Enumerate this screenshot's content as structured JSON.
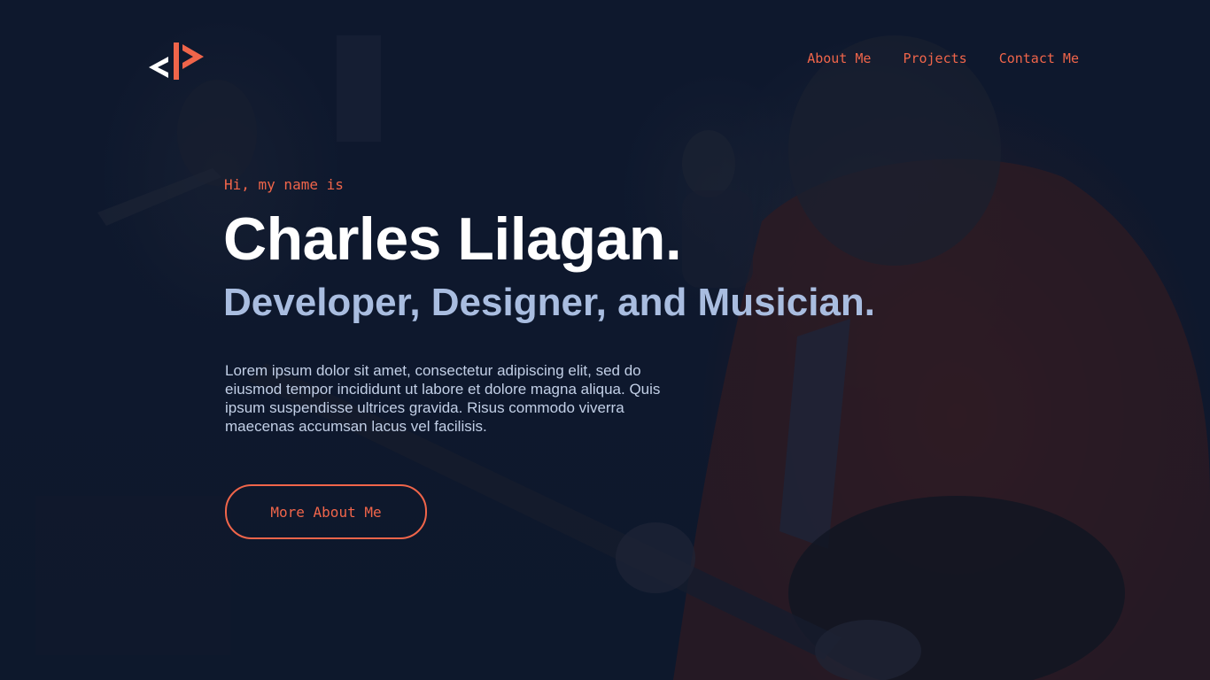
{
  "brand": {
    "logo_icon": "code-brackets-logo-icon",
    "accent_color": "#f0654a",
    "white_color": "#ffffff"
  },
  "nav": {
    "items": [
      {
        "label": "About Me"
      },
      {
        "label": "Projects"
      },
      {
        "label": "Contact Me"
      }
    ]
  },
  "hero": {
    "greeting": "Hi, my name is",
    "name": "Charles Lilagan.",
    "tagline": "Developer, Designer, and Musician.",
    "bio": "Lorem ipsum dolor sit amet, consectetur adipiscing elit, sed do eiusmod tempor incididunt ut labore et dolore magna aliqua. Quis ipsum suspendisse ultrices gravida. Risus commodo viverra maecenas accumsan lacus vel facilisis.",
    "cta_label": "More About Me"
  },
  "colors": {
    "background": "#0f1a30",
    "tagline": "#a9bde0",
    "body_text": "#c2cfe6"
  }
}
